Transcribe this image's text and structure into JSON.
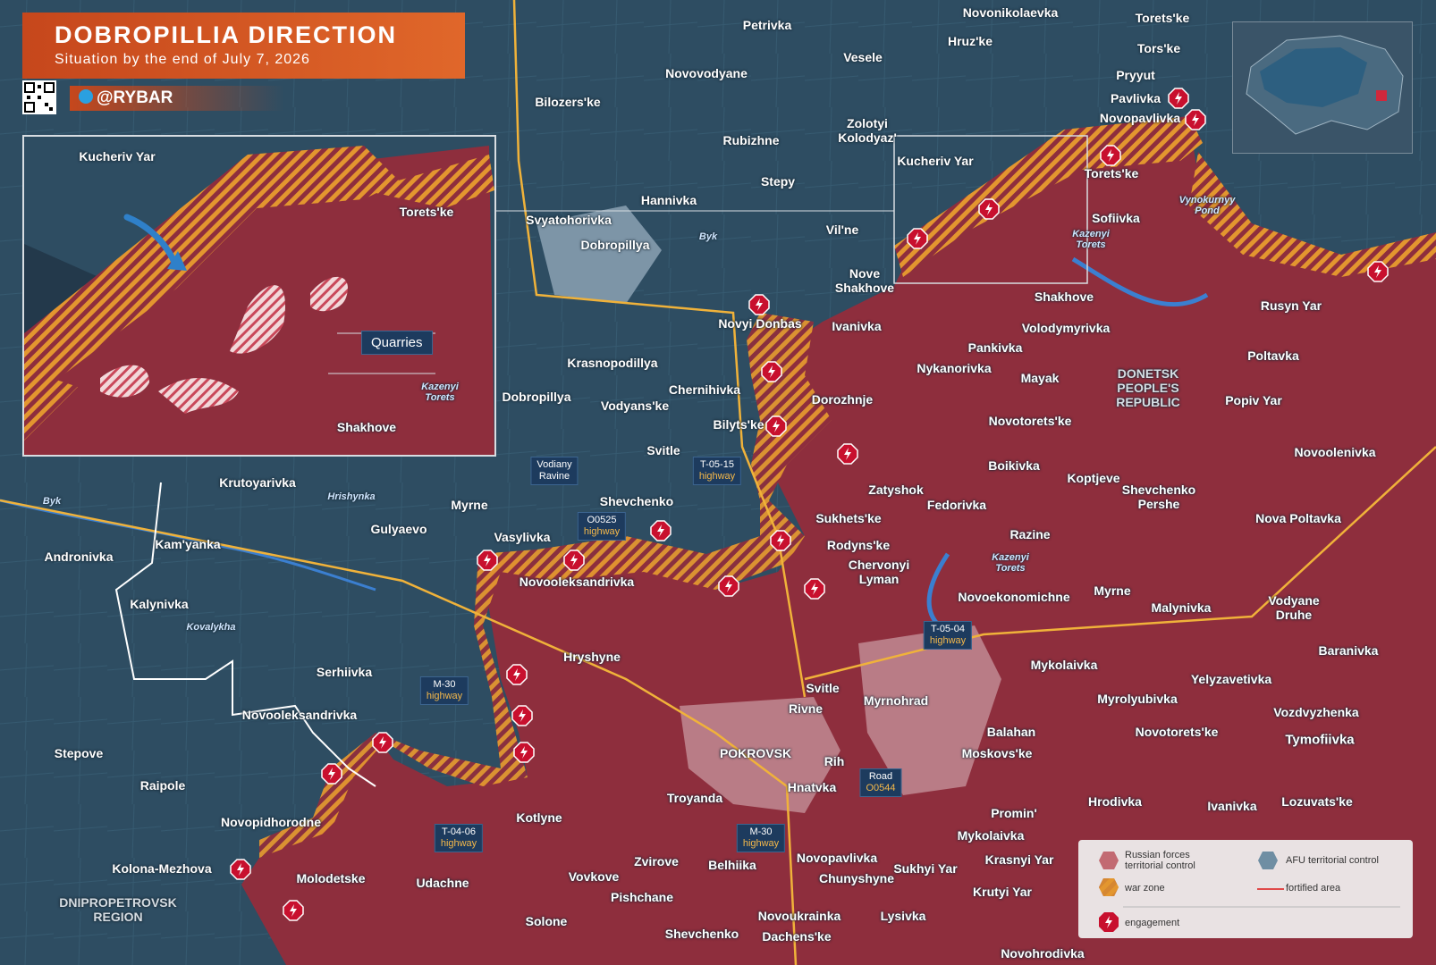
{
  "header": {
    "title": "DOBROPILLIA DIRECTION",
    "subtitle": "Situation by the end of July 7, 2026",
    "brand": "@RYBAR"
  },
  "colors": {
    "russian": "#8e2e3d",
    "afu": "#2f4c62",
    "warzone": "#e3962f",
    "engagement": "#c8102e",
    "accent": "#d85a23"
  },
  "inset": {
    "labels": [
      "Kucheriv Yar",
      "Torets'ke",
      "Shakhove"
    ],
    "water_label": "Kazenyi\nTorets",
    "quarries_label": "Quarries"
  },
  "settlements": [
    "Petrivka",
    "Novonikolaevka",
    "Torets'ke",
    "Hruz'ke",
    "Tors'ke",
    "Pryyut",
    "Pavlivka",
    "Novopavlivka",
    "Veselе",
    "Novovodyane",
    "Bilozers'ke",
    "Zolotyi\nKolodyaz'",
    "Rubizhne",
    "Stepy",
    "Kucheriv Yar",
    "Torets'ke",
    "Sofiivka",
    "Hannivka",
    "Svyatohorivka",
    "Dobropillya",
    "Vil'ne",
    "Nove\nShakhove",
    "Shakhove",
    "Novyi Donbas",
    "Ivanivka",
    "Rusyn Yar",
    "Volodymyrivka",
    "Pankivka",
    "Poltavka",
    "Mayak",
    "Nykanorivka",
    "Krasnopodillya",
    "Chernihivka",
    "Dobropillya",
    "Vodyans'ke",
    "Dorozhnje",
    "Popiv Yar",
    "Bilyts'ke",
    "Novotorets'ke",
    "Svitle",
    "Boikivka",
    "Novoolenivka",
    "Krutoyarivka",
    "Zatyshok",
    "Koptjeve",
    "Shevchenko\nPershe",
    "Shevchenko",
    "Fedorivka",
    "Myrne",
    "Sukhets'ke",
    "Nova Poltavka",
    "Gulyaevo",
    "Razine",
    "Vasylivka",
    "Andronivka",
    "Kam'yanka",
    "Rodyns'ke",
    "Novooleksandrivka",
    "Chervonyi\nLyman",
    "Kalynivka",
    "Novoekonomichne",
    "Myrne",
    "Malynivka",
    "Vodyane\nDruhe",
    "Hryshyne",
    "Baranivka",
    "Mykolaivka",
    "Serhiivka",
    "Yelyzavetivka",
    "Svitle",
    "Myrnohrad",
    "Novooleksandrivka",
    "Myrolyubivka",
    "Rivne",
    "Vozdvyzhenka",
    "Balahan",
    "Stepove",
    "Novotorets'ke",
    "Tymofiivka",
    "POKROVSK",
    "Rih",
    "Moskovs'ke",
    "Raipole",
    "Hnatvka",
    "Hrodivka",
    "Ivanivka",
    "Lozuvats'ke",
    "Troyanda",
    "Promin'",
    "Novopidhorodne",
    "Kotlyne",
    "Mykolaivka",
    "Zvirove",
    "Novopavlivka",
    "Krasnyi Yar",
    "Belhiika",
    "Sukhyi Yar",
    "Kolona-Mezhova",
    "Chunyshyne",
    "Molodetske",
    "Udachne",
    "Vovkove",
    "Krutyi Yar",
    "Pishchane",
    "Novoukrainka",
    "Lysivka",
    "Solone",
    "Shevchenko",
    "Dachens'ke",
    "Novohrodivka"
  ],
  "regions": [
    "DONETSK\nPEOPLE'S\nREPUBLIC",
    "DNIPROPETROVSK\nREGION"
  ],
  "rivers": [
    "Byk",
    "Byk",
    "Hrishynka",
    "Kovalykha"
  ],
  "waters": [
    "Vynokurnyy\nPond",
    "Kazenyi\nTorets",
    "Kazenyi\nTorets"
  ],
  "highways": [
    {
      "code": "T-05-15",
      "label": "highway"
    },
    {
      "code": "O0525",
      "label": "highway"
    },
    {
      "code": "T-05-04",
      "label": "highway"
    },
    {
      "code": "M-30",
      "label": "highway"
    },
    {
      "code": "Road",
      "label": "O0544"
    },
    {
      "code": "T-04-06",
      "label": "highway"
    },
    {
      "code": "M-30",
      "label": "highway"
    }
  ],
  "ravine": "Vodiany\nRavine",
  "legend": {
    "russian": "Russian forces\nterritorial control",
    "afu": "AFU territorial control",
    "warzone": "war zone",
    "fortified": "fortified area",
    "engagement": "engagement"
  }
}
